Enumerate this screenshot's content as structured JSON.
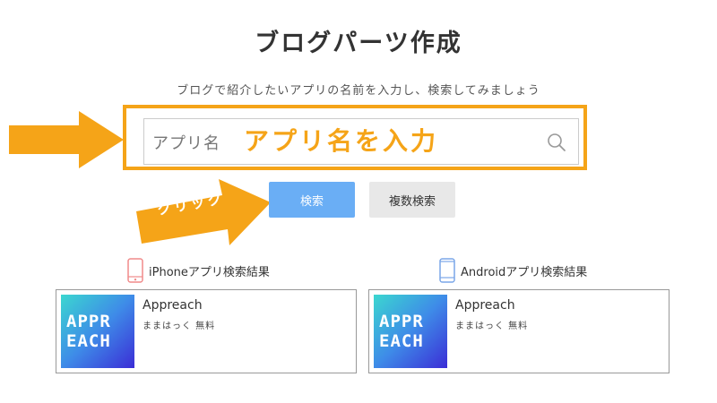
{
  "header": {
    "title": "ブログパーツ作成",
    "subtitle": "ブログで紹介したいアプリの名前を入力し、検索してみましょう"
  },
  "search": {
    "placeholder": "アプリ名",
    "annotation": "アプリ名を入力",
    "icon": "search-icon"
  },
  "buttons": {
    "search_label": "検索",
    "multi_search_label": "複数検索"
  },
  "annotations": {
    "click_label": "クリック",
    "arrow_color": "#f5a418"
  },
  "results": {
    "ios": {
      "label": "iPhoneアプリ検索結果",
      "icon": "iphone-icon",
      "app": {
        "name": "Appreach",
        "meta": "ままはっく 無料",
        "icon_line1": "APPR",
        "icon_line2": "EACH"
      }
    },
    "android": {
      "label": "Androidアプリ検索結果",
      "icon": "android-phone-icon",
      "app": {
        "name": "Appreach",
        "meta": "ままはっく 無料",
        "icon_line1": "APPR",
        "icon_line2": "EACH"
      }
    }
  },
  "colors": {
    "accent_orange": "#f5a418",
    "button_blue": "#6aaef5",
    "button_gray": "#e8e8e8",
    "iphone_icon": "#f08a8a",
    "android_icon": "#7aa6e8"
  }
}
